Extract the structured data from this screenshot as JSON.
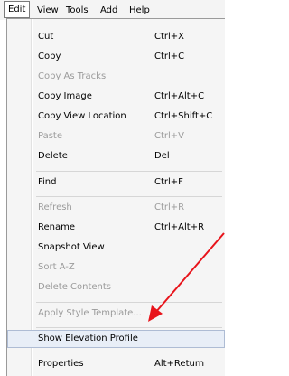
{
  "menubar": {
    "items": [
      {
        "label": "Edit"
      },
      {
        "label": "View"
      },
      {
        "label": "Tools"
      },
      {
        "label": "Add"
      },
      {
        "label": "Help"
      }
    ]
  },
  "menu": {
    "items": [
      {
        "label": "Cut",
        "shortcut": "Ctrl+X",
        "enabled": true
      },
      {
        "label": "Copy",
        "shortcut": "Ctrl+C",
        "enabled": true
      },
      {
        "label": "Copy As Tracks",
        "shortcut": "",
        "enabled": false
      },
      {
        "label": "Copy Image",
        "shortcut": "Ctrl+Alt+C",
        "enabled": true
      },
      {
        "label": "Copy View Location",
        "shortcut": "Ctrl+Shift+C",
        "enabled": true
      },
      {
        "label": "Paste",
        "shortcut": "Ctrl+V",
        "enabled": false
      },
      {
        "label": "Delete",
        "shortcut": "Del",
        "enabled": true
      },
      {
        "label": "Find",
        "shortcut": "Ctrl+F",
        "enabled": true
      },
      {
        "label": "Refresh",
        "shortcut": "Ctrl+R",
        "enabled": false
      },
      {
        "label": "Rename",
        "shortcut": "Ctrl+Alt+R",
        "enabled": true
      },
      {
        "label": "Snapshot View",
        "shortcut": "",
        "enabled": true
      },
      {
        "label": "Sort A-Z",
        "shortcut": "",
        "enabled": false
      },
      {
        "label": "Delete Contents",
        "shortcut": "",
        "enabled": false
      },
      {
        "label": "Apply Style Template...",
        "shortcut": "",
        "enabled": false
      },
      {
        "label": "Show Elevation Profile",
        "shortcut": "",
        "enabled": true,
        "highlighted": true
      },
      {
        "label": "Properties",
        "shortcut": "Alt+Return",
        "enabled": true
      }
    ]
  },
  "colors": {
    "arrow": "#e8141b",
    "highlight": "#e8eef7",
    "disabled_text": "#9b9b9b"
  }
}
